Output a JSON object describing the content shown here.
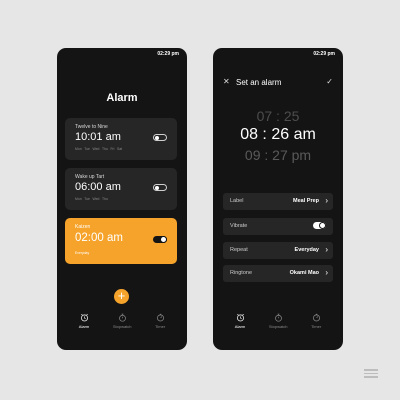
{
  "left_screen": {
    "status_time": "02:29 pm",
    "title": "Alarm",
    "alarms": [
      {
        "label": "Twelve to Nine",
        "time": "10:01 am",
        "days": [
          "Mon",
          "Tue",
          "Wed",
          "Thu",
          "Fri",
          "Sat"
        ],
        "enabled": false
      },
      {
        "label": "Wake up Tart",
        "time": "06:00 am",
        "days": [
          "Mon",
          "Tue",
          "Wed",
          "Thu"
        ],
        "enabled": false
      },
      {
        "label": "Kaizen",
        "time": "02:00 am",
        "days": [
          "Everyday"
        ],
        "enabled": true
      }
    ],
    "fab_symbol": "+",
    "nav": [
      {
        "label": "Alarm",
        "icon": "alarm-clock-icon",
        "active": true
      },
      {
        "label": "Stopwatch",
        "icon": "stopwatch-icon",
        "active": false
      },
      {
        "label": "Timer",
        "icon": "timer-icon",
        "active": false
      }
    ]
  },
  "right_screen": {
    "status_time": "02:29 pm",
    "header_title": "Set an alarm",
    "picker": [
      {
        "text": "07 : 25"
      },
      {
        "text": "08 : 26 am"
      },
      {
        "text": "09 : 27 pm"
      }
    ],
    "settings": [
      {
        "label": "Label",
        "value": "Meal Prep"
      },
      {
        "label": "Vibrate",
        "value": "",
        "toggle_on": true
      },
      {
        "label": "Repeat",
        "value": "Everyday"
      },
      {
        "label": "Ringtone",
        "value": "Okami Mao"
      }
    ],
    "nav": [
      {
        "label": "Alarm",
        "icon": "alarm-clock-icon",
        "active": true
      },
      {
        "label": "Stopwatch",
        "icon": "stopwatch-icon",
        "active": false
      },
      {
        "label": "Timer",
        "icon": "timer-icon",
        "active": false
      }
    ]
  },
  "colors": {
    "accent": "#f5a32b",
    "background": "#141414",
    "card": "#262626",
    "page": "#e6e6e6"
  }
}
